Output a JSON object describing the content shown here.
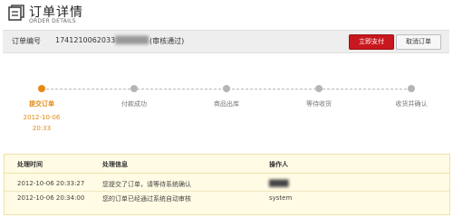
{
  "header": {
    "title": "订单详情",
    "subtitle": "ORDER DETAILS",
    "icon": "document-icon"
  },
  "order_bar": {
    "label": "订单编号",
    "number": "1741210062033",
    "number_hidden": "██████",
    "status": "(审核通过)",
    "pay_button": "立即支付",
    "cancel_button": "取消订单",
    "colors": {
      "pay": "#c8171e",
      "bar": "#eeeeee"
    }
  },
  "progress": {
    "active_color": "#e38a12",
    "steps": [
      {
        "label": "提交订单",
        "active": true,
        "time": "2012-10-06\n20:33"
      },
      {
        "label": "付款成功",
        "active": false
      },
      {
        "label": "商品出库",
        "active": false
      },
      {
        "label": "等待收货",
        "active": false
      },
      {
        "label": "收货并确认",
        "active": false
      }
    ],
    "step1_date": "2012-10-06",
    "step1_clock": "20:33"
  },
  "log": {
    "headers": [
      "处理时间",
      "处理信息",
      "操作人"
    ],
    "rows": [
      {
        "time": "2012-10-06 20:33:27",
        "info": "您提交了订单，请等待系统确认",
        "operator": "████"
      },
      {
        "time": "2012-10-06 20:34:00",
        "info": "您的订单已经通过系统自动审核",
        "operator": "system"
      }
    ],
    "colors": {
      "background": "#fffbe4"
    }
  }
}
